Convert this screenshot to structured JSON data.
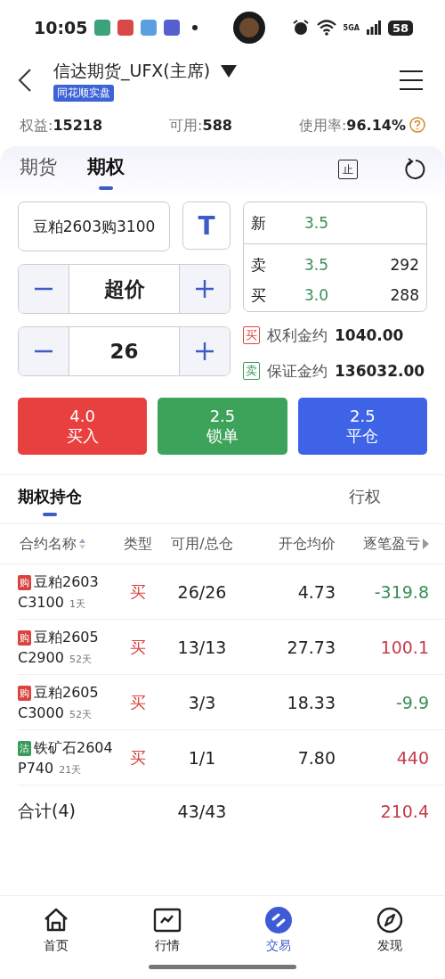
{
  "status_bar": {
    "time": "10:05",
    "network": "5GA",
    "battery": "58"
  },
  "header": {
    "title": "信达期货_UFX(主席)",
    "badge": "同花顺实盘"
  },
  "account": [
    {
      "label": "权益:",
      "value": "15218"
    },
    {
      "label": "可用:",
      "value": "588"
    },
    {
      "label": "使用率:",
      "value": "96.14%"
    }
  ],
  "product_tabs": [
    {
      "label": "期货",
      "selected": false
    },
    {
      "label": "期权",
      "selected": true
    }
  ],
  "stop_label": "止",
  "order": {
    "contract": "豆粕2603购3100",
    "t_label": "T",
    "price_mode": "超价",
    "quantity": "26"
  },
  "quote": [
    {
      "label": "新",
      "price": "3.5"
    },
    {
      "label": "卖",
      "price": "3.5",
      "volume": "292"
    },
    {
      "label": "买",
      "price": "3.0",
      "volume": "288"
    }
  ],
  "margins": [
    {
      "tag": "买",
      "color": "#d9443f",
      "label": "权利金约",
      "value": "1040.00"
    },
    {
      "tag": "卖",
      "color": "#3a9a5a",
      "label": "保证金约",
      "value": "136032.00"
    }
  ],
  "actions": [
    {
      "price": "4.0",
      "label": "买入",
      "color": "#e8403f"
    },
    {
      "price": "2.5",
      "label": "锁单",
      "color": "#3ea35a"
    },
    {
      "price": "2.5",
      "label": "平仓",
      "color": "#3e63e6"
    }
  ],
  "position_tabs": [
    {
      "label": "期权持仓",
      "selected": true
    },
    {
      "label": "行权",
      "selected": false
    }
  ],
  "columns": [
    "合约名称",
    "类型",
    "可用/总仓",
    "开仓均价",
    "逐笔盈亏"
  ],
  "rows": [
    {
      "tag": "购",
      "color": "#d9443f",
      "name": "豆粕2603",
      "strike": "C3100",
      "days": "1天",
      "side": "买",
      "available": "26/26",
      "avg_price": "4.73",
      "pnl": "-319.8",
      "kind": "loss"
    },
    {
      "tag": "购",
      "color": "#d9443f",
      "name": "豆粕2605",
      "strike": "C2900",
      "days": "52天",
      "side": "买",
      "available": "13/13",
      "avg_price": "27.73",
      "pnl": "100.1",
      "kind": "profit"
    },
    {
      "tag": "购",
      "color": "#d9443f",
      "name": "豆粕2605",
      "strike": "C3000",
      "days": "52天",
      "side": "买",
      "available": "3/3",
      "avg_price": "18.33",
      "pnl": "-9.9",
      "kind": "loss"
    },
    {
      "tag": "沽",
      "color": "#3a9a5a",
      "name": "铁矿石2604",
      "strike": "P740",
      "days": "21天",
      "side": "买",
      "available": "1/1",
      "avg_price": "7.80",
      "pnl": "440",
      "kind": "profit"
    }
  ],
  "total": {
    "label": "合计(4)",
    "available": "43/43",
    "pnl": "210.4",
    "kind": "profit"
  },
  "nav": [
    {
      "label": "首页",
      "selected": false
    },
    {
      "label": "行情",
      "selected": false
    },
    {
      "label": "交易",
      "selected": true
    },
    {
      "label": "发现",
      "selected": false
    }
  ]
}
